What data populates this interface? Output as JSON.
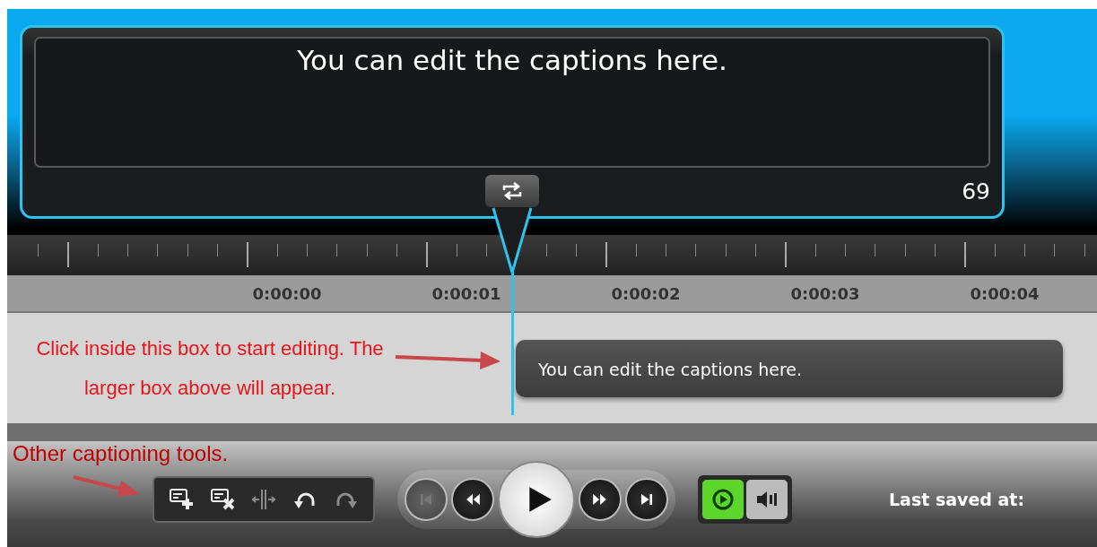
{
  "editor": {
    "caption_text": "You can edit the captions here.",
    "char_count": "69"
  },
  "timeline": {
    "time_labels": [
      "0:00:00",
      "0:00:01",
      "0:00:02",
      "0:00:03",
      "0:00:04"
    ]
  },
  "caption_clip": {
    "text": "You can edit the captions here."
  },
  "annotations": [
    {
      "text": "Click inside this box to start editing. The larger box above will appear."
    },
    {
      "text": "Other captioning tools."
    }
  ],
  "toolbar": {
    "caption_tools": [
      {
        "kind": "add",
        "disabled": false
      },
      {
        "kind": "delete",
        "disabled": false
      },
      {
        "kind": "split",
        "disabled": true
      },
      {
        "kind": "undo",
        "disabled": false
      },
      {
        "kind": "redo",
        "disabled": true
      }
    ],
    "playback": [
      {
        "kind": "skip_start",
        "disabled": true
      },
      {
        "kind": "rewind",
        "disabled": false
      },
      {
        "kind": "play",
        "disabled": false
      },
      {
        "kind": "fast_forward",
        "disabled": false
      },
      {
        "kind": "skip_end",
        "disabled": false
      }
    ],
    "toggles": [
      {
        "kind": "sync",
        "on": true
      },
      {
        "kind": "audio",
        "on": false
      }
    ],
    "last_saved_label": "Last saved at:"
  }
}
